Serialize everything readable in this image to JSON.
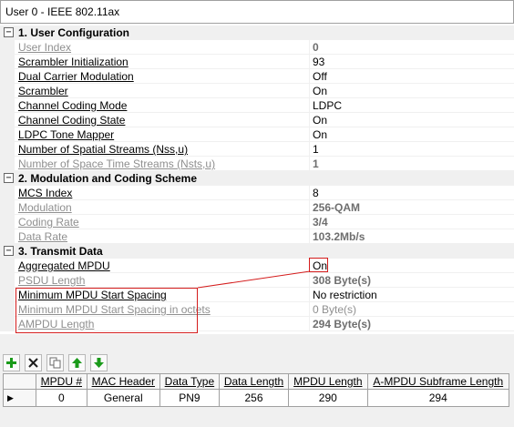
{
  "window": {
    "title": "User 0 - IEEE 802.11ax"
  },
  "sections": [
    {
      "label": "1. User Configuration",
      "toggle": "−",
      "props": [
        {
          "name": "User Index",
          "value": "0",
          "disabled": true,
          "bold": true
        },
        {
          "name": "Scrambler Initialization",
          "value": "93",
          "disabled": false,
          "bold": false
        },
        {
          "name": "Dual Carrier Modulation",
          "value": "Off",
          "disabled": false,
          "bold": false
        },
        {
          "name": "Scrambler",
          "value": "On",
          "disabled": false,
          "bold": false
        },
        {
          "name": "Channel Coding Mode",
          "value": "LDPC",
          "disabled": false,
          "bold": false
        },
        {
          "name": "Channel Coding State",
          "value": "On",
          "disabled": false,
          "bold": false
        },
        {
          "name": "LDPC Tone Mapper",
          "value": "On",
          "disabled": false,
          "bold": false
        },
        {
          "name": "Number of Spatial Streams (Nss,u)",
          "value": "1",
          "disabled": false,
          "bold": false
        },
        {
          "name": "Number of Space Time Streams (Nsts,u)",
          "value": "1",
          "disabled": true,
          "bold": true
        }
      ]
    },
    {
      "label": "2. Modulation and Coding Scheme",
      "toggle": "−",
      "props": [
        {
          "name": "MCS Index",
          "value": "8",
          "disabled": false,
          "bold": false
        },
        {
          "name": "Modulation",
          "value": "256-QAM",
          "disabled": true,
          "bold": true
        },
        {
          "name": "Coding Rate",
          "value": "3/4",
          "disabled": true,
          "bold": true
        },
        {
          "name": "Data Rate",
          "value": "103.2Mb/s",
          "disabled": true,
          "bold": true
        }
      ]
    },
    {
      "label": "3. Transmit Data",
      "toggle": "−",
      "props": [
        {
          "name": "Aggregated MPDU",
          "value": "On",
          "disabled": false,
          "bold": false
        },
        {
          "name": "PSDU Length",
          "value": "308 Byte(s)",
          "disabled": true,
          "bold": true
        },
        {
          "name": "Minimum MPDU Start Spacing",
          "value": "No restriction",
          "disabled": false,
          "bold": false
        },
        {
          "name": "Minimum MPDU Start Spacing in octets",
          "value": "0 Byte(s)",
          "disabled": true,
          "bold": false
        },
        {
          "name": "AMPDU Length",
          "value": "294 Byte(s)",
          "disabled": true,
          "bold": true
        }
      ]
    }
  ],
  "toolbar": [
    {
      "icon": "add-icon",
      "color": "#1a9a1a"
    },
    {
      "icon": "delete-icon",
      "color": "#202020"
    },
    {
      "icon": "copy-icon",
      "color": "#6a6a6a"
    },
    {
      "icon": "move-up-icon",
      "color": "#1a9a1a"
    },
    {
      "icon": "move-down-icon",
      "color": "#1a9a1a"
    }
  ],
  "mpdu_table": {
    "columns": [
      "MPDU #",
      "MAC Header",
      "Data Type",
      "Data Length",
      "MPDU Length",
      "A-MPDU Subframe Length"
    ],
    "rows": [
      {
        "marker": "▶",
        "cells": [
          "0",
          "General",
          "PN9",
          "256",
          "290",
          "294"
        ]
      }
    ]
  },
  "colors": {
    "highlight": "#d41c1c",
    "category_bg": "#f0f0f0",
    "disabled_text": "#8f8f8f"
  }
}
